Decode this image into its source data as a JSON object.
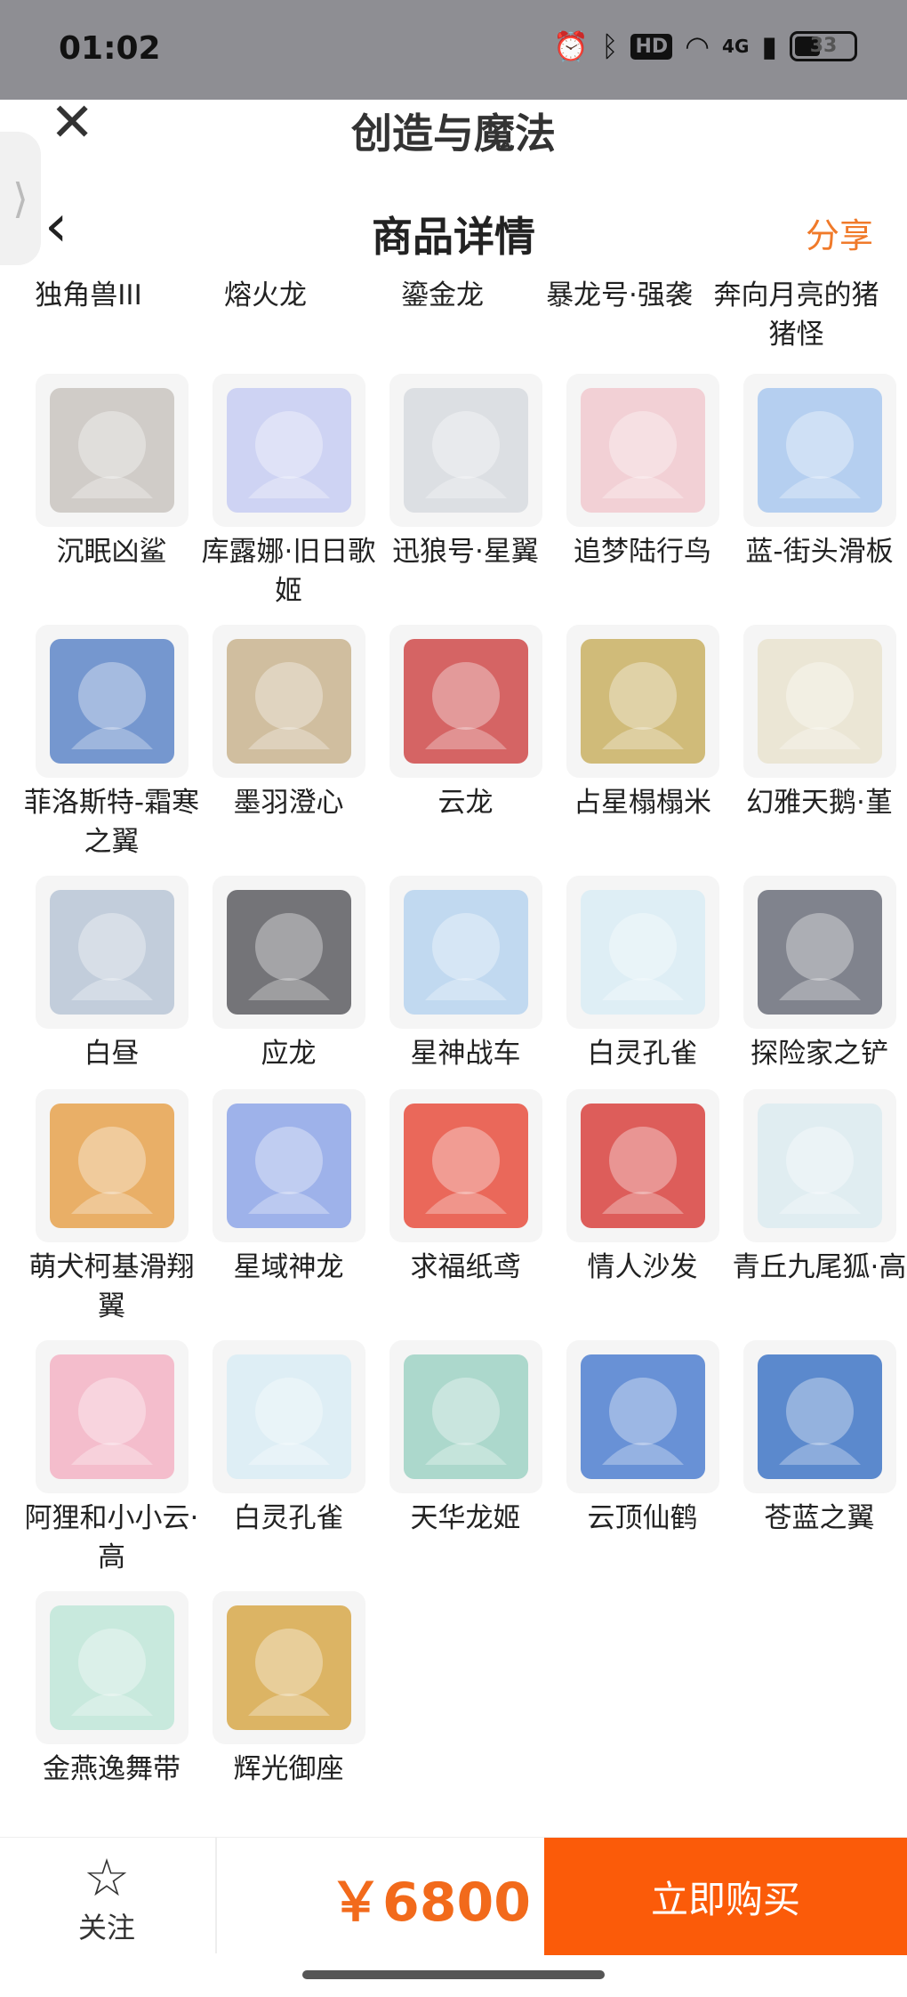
{
  "status": {
    "time": "01:02",
    "hd": "HD",
    "network": "4G",
    "battery": "33"
  },
  "app": {
    "title": "创造与魔法"
  },
  "header": {
    "title": "商品详情",
    "share": "分享"
  },
  "top_names": [
    "独角兽III",
    "熔火龙",
    "鎏金龙",
    "暴龙号·强袭",
    "奔向月亮的猪猪怪"
  ],
  "items": [
    {
      "name": "沉眠凶鲨",
      "color": "#c9c4bf"
    },
    {
      "name": "库露娜·旧日歌姬",
      "color": "#c7cdf2"
    },
    {
      "name": "迅狼号·星翼",
      "color": "#d7dadf"
    },
    {
      "name": "追梦陆行鸟",
      "color": "#f1c9cf"
    },
    {
      "name": "蓝-街头滑板",
      "color": "#a9c8ef"
    },
    {
      "name": "菲洛斯特-霜寒之翼",
      "color": "#5e86c8"
    },
    {
      "name": "墨羽澄心",
      "color": "#c9b48f"
    },
    {
      "name": "云龙",
      "color": "#cf4a4a"
    },
    {
      "name": "占星榻榻米",
      "color": "#c9b063"
    },
    {
      "name": "幻雅天鹅·堇",
      "color": "#e9e3cf"
    },
    {
      "name": "白昼",
      "color": "#b9c6d6"
    },
    {
      "name": "应龙",
      "color": "#5d5d62"
    },
    {
      "name": "星神战车",
      "color": "#b7d4ef"
    },
    {
      "name": "白灵孔雀",
      "color": "#d9ecf5"
    },
    {
      "name": "探险家之铲",
      "color": "#6b6f7a"
    },
    {
      "name": "萌犬柯基滑翔翼",
      "color": "#e6a24e"
    },
    {
      "name": "星域神龙",
      "color": "#8ea6e8"
    },
    {
      "name": "求福纸鸢",
      "color": "#e84f3e"
    },
    {
      "name": "情人沙发",
      "color": "#d8423e"
    },
    {
      "name": "青丘九尾狐·高",
      "color": "#dcebf0"
    },
    {
      "name": "阿狸和小小云·高",
      "color": "#f3b3c4"
    },
    {
      "name": "白灵孔雀",
      "color": "#d9ecf5"
    },
    {
      "name": "天华龙姬",
      "color": "#9fd2c4"
    },
    {
      "name": "云顶仙鹤",
      "color": "#4f7fd0"
    },
    {
      "name": "苍蓝之翼",
      "color": "#3f75c6"
    },
    {
      "name": "金燕逸舞带",
      "color": "#bfe6d8"
    },
    {
      "name": "辉光御座",
      "color": "#d7a84a"
    }
  ],
  "bottom": {
    "follow": "关注",
    "price": "￥6800",
    "buy": "立即购买"
  }
}
